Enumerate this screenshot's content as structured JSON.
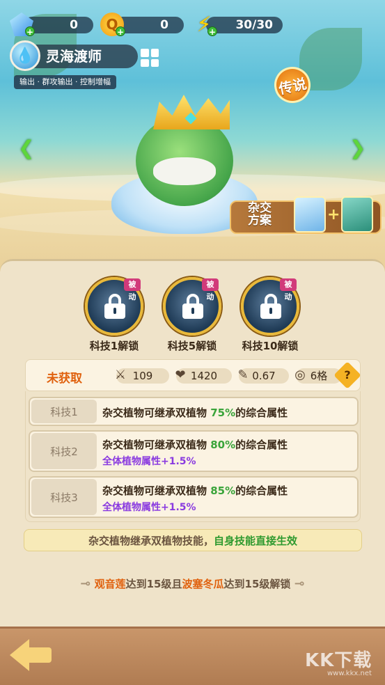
{
  "resources": [
    {
      "icon": "gem-icon",
      "value": "0"
    },
    {
      "icon": "coin-icon",
      "value": "0"
    },
    {
      "icon": "energy-bolt-icon",
      "value": "30/30"
    }
  ],
  "plant": {
    "name": "灵海渡师",
    "tags": "输出 · 群攻输出 · 控制增幅",
    "rarity": "传说",
    "hybrid_label_line1": "杂交",
    "hybrid_label_line2": "方案"
  },
  "skills": [
    {
      "badge": "被动",
      "unlock": "科技1解锁"
    },
    {
      "badge": "被动",
      "unlock": "科技5解锁"
    },
    {
      "badge": "被动",
      "unlock": "科技10解锁"
    }
  ],
  "stats": {
    "status": "未获取",
    "attack": "109",
    "health": "1420",
    "speed": "0.67",
    "range": "6格"
  },
  "techs": [
    {
      "label": "科技1",
      "pre": "杂交植物可继承双植物 ",
      "pct": "75%",
      "post": "的综合属性",
      "extra": ""
    },
    {
      "label": "科技2",
      "pre": "杂交植物可继承双植物 ",
      "pct": "80%",
      "post": "的综合属性",
      "extra": "全体植物属性+1.5%"
    },
    {
      "label": "科技3",
      "pre": "杂交植物可继承双植物 ",
      "pct": "85%",
      "post": "的综合属性",
      "extra": "全体植物属性+1.5%"
    }
  ],
  "banner": {
    "text": "杂交植物继承双植物技能，",
    "highlight": "自身技能直接生效"
  },
  "condition": {
    "a": "观音莲",
    "mid1": "达到15级且",
    "b": "波塞冬瓜",
    "mid2": "达到15级解锁"
  },
  "watermark": {
    "main": "KK下载",
    "sub": "www.kkx.net"
  },
  "colors": {
    "accent_orange": "#e0610e",
    "accent_green": "#3aa43a",
    "accent_purple": "#8a3be0"
  }
}
